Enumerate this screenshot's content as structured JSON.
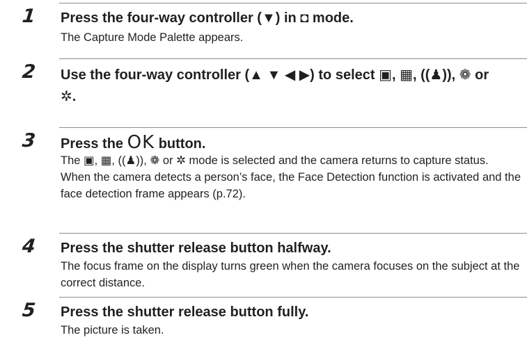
{
  "steps": [
    {
      "number": "1",
      "title": "Press the four-way controller (▼) in ◘ mode.",
      "description": [
        "The Capture Mode Palette appears."
      ]
    },
    {
      "number": "2",
      "title": "Use the four-way controller (▲ ▼ ◀ ▶) to select ▣, ▦, ((♟)), ❁ or ✲.",
      "description": []
    },
    {
      "number": "3",
      "title_prefix": "Press the",
      "title_ok": "OK",
      "title_suffix": "button.",
      "description": [
        "The ▣, ▦, ((♟)), ❁ or ✲ mode is selected and the camera returns to capture status.",
        "When the camera detects a person’s face, the Face Detection function is activated and the face detection frame appears (p.72)."
      ]
    },
    {
      "number": "4",
      "title": "Press the shutter release button halfway.",
      "description": [
        "The focus frame on the display turns green when the camera focuses on the subject at the correct distance."
      ]
    },
    {
      "number": "5",
      "title": "Press the shutter release button fully.",
      "description": [
        "The picture is taken."
      ]
    }
  ]
}
